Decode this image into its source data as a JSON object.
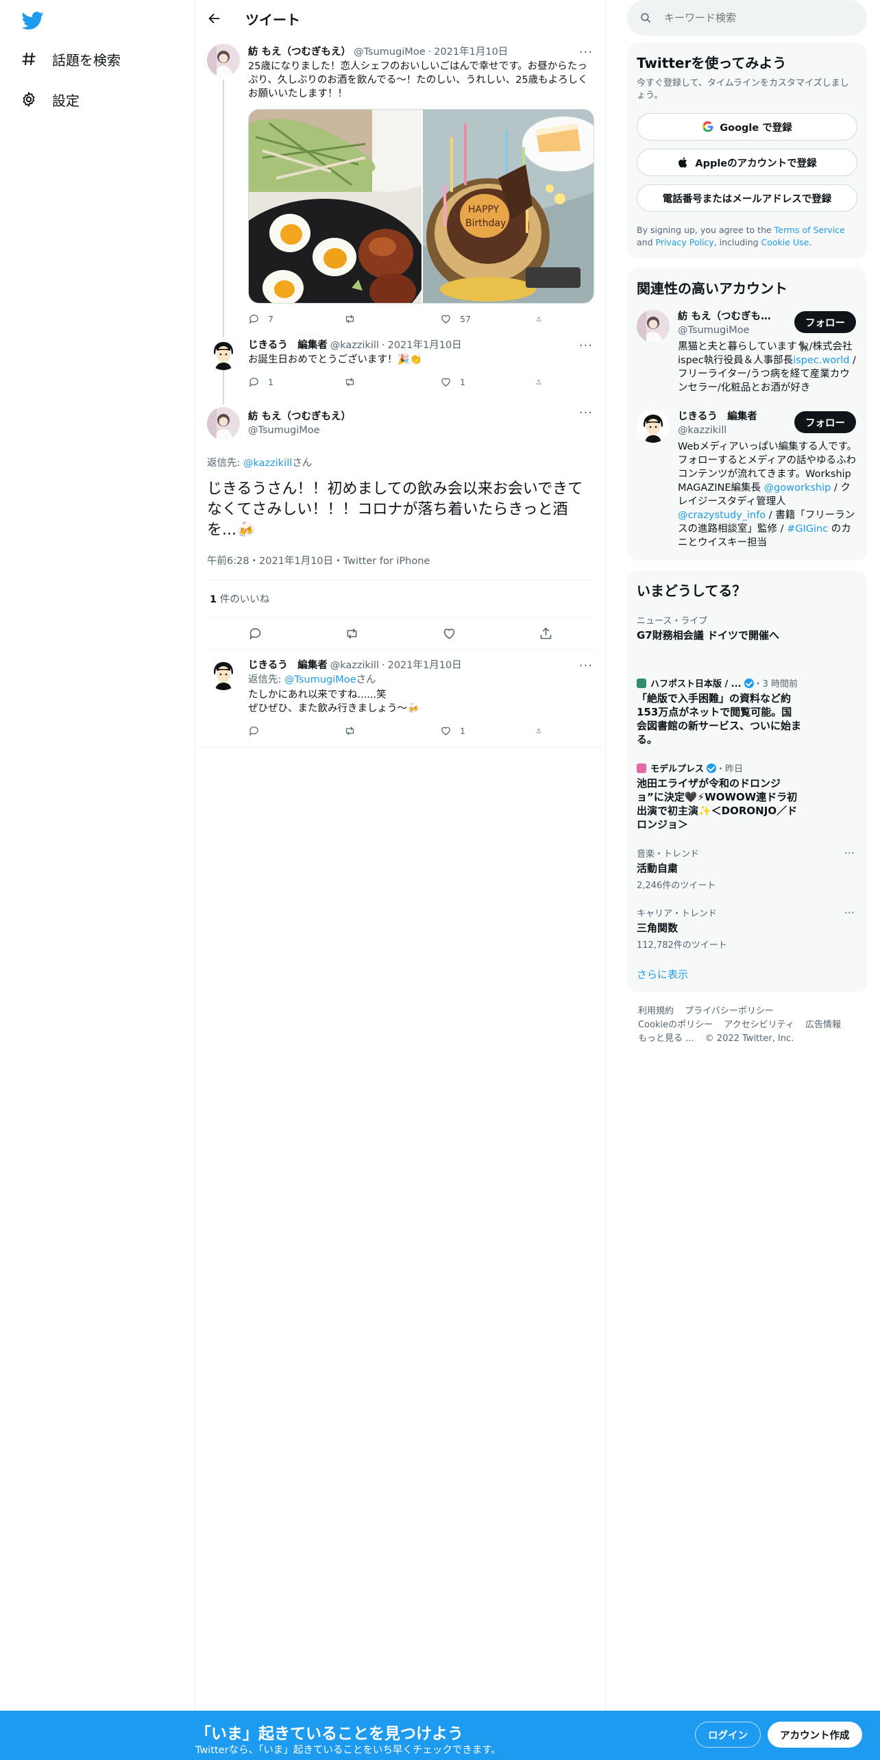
{
  "nav": {
    "explore_label": "話題を検索",
    "settings_label": "設定"
  },
  "header": {
    "title": "ツイート"
  },
  "thread": {
    "tweet1": {
      "name": "紡 もえ（つむぎもえ）",
      "handle": "@TsumugiMoe",
      "date": "2021年1月10日",
      "text": "25歳になりました！恋人シェフのおいしいごはんで幸せです。お昼からたっぷり、久しぶりのお酒を飲んでる〜！たのしい、うれしい、25歳もよろしくお願いいたします！！",
      "replies": "7",
      "retweets": "",
      "likes": "57"
    },
    "tweet2": {
      "name": "じきるう　編集者",
      "handle": "@kazzikill",
      "date": "2021年1月10日",
      "text": "お誕生日おめでとうございます！🎉👏",
      "replies": "1",
      "retweets": "",
      "likes": "1"
    },
    "focal": {
      "name": "紡 もえ（つむぎもえ）",
      "handle": "@TsumugiMoe",
      "reply_prefix": "返信先: ",
      "reply_to": "@kazzikill",
      "reply_suffix": "さん",
      "text": "じきるうさん！！初めましての飲み会以来お会いできてなくてさみしい！！！コロナが落ち着いたらきっと酒を...🍻",
      "meta": "午前6:28・2021年1月10日・Twitter for iPhone",
      "likes_count": "1",
      "likes_label": " 件のいいね"
    },
    "tweet3": {
      "name": "じきるう　編集者",
      "handle": "@kazzikill",
      "date": "2021年1月10日",
      "reply_prefix": "返信先: ",
      "reply_to": "@TsumugiMoe",
      "reply_suffix": "さん",
      "line1": "たしかにあれ以来ですね......笑",
      "line2": "ぜひぜひ、また飲み行きましょう〜🍻",
      "replies": "",
      "retweets": "",
      "likes": "1"
    }
  },
  "search": {
    "placeholder": "キーワード検索"
  },
  "signup_card": {
    "title": "Twitterを使ってみよう",
    "subtitle": "今すぐ登録して、タイムラインをカスタマイズしましょう。",
    "google": "Google で登録",
    "apple": "Appleのアカウントで登録",
    "phone": "電話番号またはメールアドレスで登録",
    "terms_1": "By signing up, you agree to the ",
    "terms_link1": "Terms of Service",
    "terms_2": " and ",
    "terms_link2": "Privacy Policy",
    "terms_3": ", including ",
    "terms_link3": "Cookie Use",
    "terms_4": "."
  },
  "related": {
    "title": "関連性の高いアカウント",
    "follow_label": "フォロー",
    "accounts": [
      {
        "name": "紡 もえ（つむぎもえ）",
        "handle": "@TsumugiMoe",
        "bio1": "黒猫と夫と暮らしています🐈‍⬛/株式会社ispec執行役員＆人事部長",
        "bio_link": "ispec.world",
        "bio2": " /フリーライター/うつ病を経て産業カウンセラー/化粧品とお酒が好き"
      },
      {
        "name": "じきるう　編集者",
        "handle": "@kazzikill",
        "bio1": "Webメディアいっぱい編集する人です。フォローするとメディアの話やゆるふわコンテンツが流れてきます。Workship MAGAZINE編集長 ",
        "bio_link": "@goworkship",
        "bio2": " / クレイジースタディ管理人 ",
        "bio_link2": "@crazystudy_info",
        "bio3": " / 書籍「フリーランスの進路相談室」監修 / ",
        "bio_link3": "#GIGinc",
        "bio4": " のカニとウイスキー担当"
      }
    ]
  },
  "trends": {
    "title": "いまどうしてる？",
    "items": [
      {
        "meta": "ニュース・ライブ",
        "title": "G7財務相会議 ドイツで開催へ",
        "count": ""
      },
      {
        "meta_source": "ハフポスト日本版 / ...",
        "meta_time": "・3 時間前",
        "title": "「絶版で入手困難」の資料など約153万点がネットで閲覧可能。国会図書館の新サービス、ついに始まる。"
      },
      {
        "meta_source": "モデルプレス",
        "meta_time": "・昨日",
        "title": "池田エライザが令和のドロンジョ”に決定🖤⚡WOWOW連ドラ初出演で初主演✨＜DORONJO／ドロンジョ＞"
      },
      {
        "meta": "音楽・トレンド",
        "title": "活動自粛",
        "count": "2,246件のツイート"
      },
      {
        "meta": "キャリア・トレンド",
        "title": "三角関数",
        "count": "112,782件のツイート"
      }
    ],
    "show_more": "さらに表示"
  },
  "footer": {
    "terms": "利用規約",
    "privacy": "プライバシーポリシー",
    "cookie": "Cookieのポリシー",
    "accessibility": "アクセシビリティ",
    "ads": "広告情報",
    "more": "もっと見る ...",
    "copyright": "© 2022 Twitter, Inc."
  },
  "bottom_bar": {
    "title": "「いま」起きていることを見つけよう",
    "subtitle": "Twitterなら、「いま」起きていることをいち早くチェックできます。",
    "login": "ログイン",
    "signup": "アカウント作成"
  },
  "colors": {
    "accent": "#1d9bf0",
    "text": "#0f1419",
    "muted": "#536471"
  }
}
